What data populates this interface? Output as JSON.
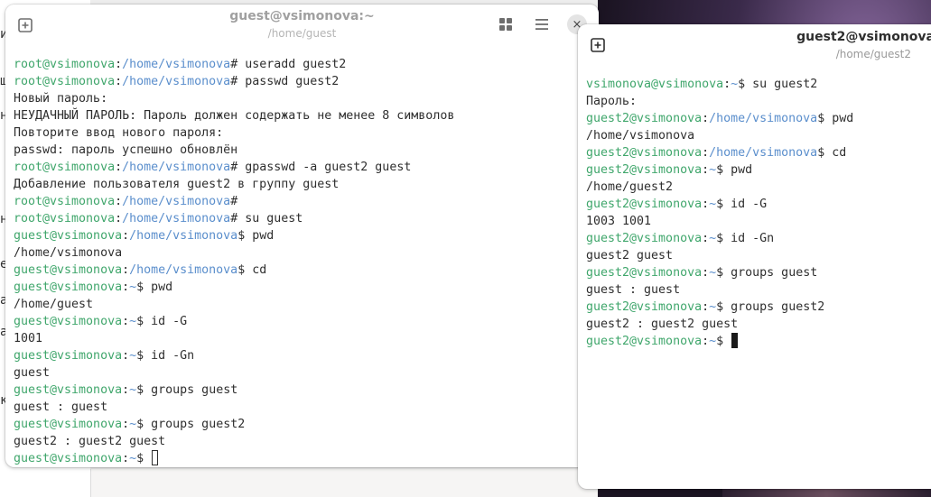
{
  "window1": {
    "title": "guest@vsimonova:~",
    "subtitle": "/home/guest",
    "lines": [
      {
        "user": "root@vsimonova",
        "path": "/home/vsimonova",
        "sym": "#",
        "cmd": " useradd guest2"
      },
      {
        "user": "root@vsimonova",
        "path": "/home/vsimonova",
        "sym": "#",
        "cmd": " passwd guest2"
      },
      {
        "text": "Новый пароль:"
      },
      {
        "text": "НЕУДАЧНЫЙ ПАРОЛЬ: Пароль должен содержать не менее 8 символов"
      },
      {
        "text": "Повторите ввод нового пароля:"
      },
      {
        "text": "passwd: пароль успешно обновлён"
      },
      {
        "user": "root@vsimonova",
        "path": "/home/vsimonova",
        "sym": "#",
        "cmd": " gpasswd -a guest2 guest"
      },
      {
        "text": "Добавление пользователя guest2 в группу guest"
      },
      {
        "user": "root@vsimonova",
        "path": "/home/vsimonova",
        "sym": "#",
        "cmd": ""
      },
      {
        "user": "root@vsimonova",
        "path": "/home/vsimonova",
        "sym": "#",
        "cmd": " su guest"
      },
      {
        "user": "guest@vsimonova",
        "path": "/home/vsimonova",
        "sym": "$",
        "cmd": " pwd"
      },
      {
        "text": "/home/vsimonova"
      },
      {
        "user": "guest@vsimonova",
        "path": "/home/vsimonova",
        "sym": "$",
        "cmd": " cd"
      },
      {
        "user": "guest@vsimonova",
        "path": "~",
        "sym": "$",
        "cmd": " pwd"
      },
      {
        "text": "/home/guest"
      },
      {
        "user": "guest@vsimonova",
        "path": "~",
        "sym": "$",
        "cmd": " id -G"
      },
      {
        "text": "1001"
      },
      {
        "user": "guest@vsimonova",
        "path": "~",
        "sym": "$",
        "cmd": " id -Gn"
      },
      {
        "text": "guest"
      },
      {
        "user": "guest@vsimonova",
        "path": "~",
        "sym": "$",
        "cmd": " groups guest"
      },
      {
        "text": "guest : guest"
      },
      {
        "user": "guest@vsimonova",
        "path": "~",
        "sym": "$",
        "cmd": " groups guest2"
      },
      {
        "text": "guest2 : guest2 guest"
      },
      {
        "user": "guest@vsimonova",
        "path": "~",
        "sym": "$",
        "cmd": " ",
        "cursor": "hollow"
      }
    ]
  },
  "window2": {
    "title": "guest2@vsimonova",
    "subtitle": "/home/guest2",
    "lines": [
      {
        "user": "vsimonova@vsimonova",
        "path": "~",
        "sym": "$",
        "cmd": " su guest2"
      },
      {
        "text": "Пароль:"
      },
      {
        "user": "guest2@vsimonova",
        "path": "/home/vsimonova",
        "sym": "$",
        "cmd": " pwd"
      },
      {
        "text": "/home/vsimonova"
      },
      {
        "user": "guest2@vsimonova",
        "path": "/home/vsimonova",
        "sym": "$",
        "cmd": " cd"
      },
      {
        "user": "guest2@vsimonova",
        "path": "~",
        "sym": "$",
        "cmd": " pwd"
      },
      {
        "text": "/home/guest2"
      },
      {
        "user": "guest2@vsimonova",
        "path": "~",
        "sym": "$",
        "cmd": " id -G"
      },
      {
        "text": "1003 1001"
      },
      {
        "user": "guest2@vsimonova",
        "path": "~",
        "sym": "$",
        "cmd": " id -Gn"
      },
      {
        "text": "guest2 guest"
      },
      {
        "user": "guest2@vsimonova",
        "path": "~",
        "sym": "$",
        "cmd": " groups guest"
      },
      {
        "text": "guest : guest"
      },
      {
        "user": "guest2@vsimonova",
        "path": "~",
        "sym": "$",
        "cmd": " groups guest2"
      },
      {
        "text": "guest2 : guest2 guest"
      },
      {
        "user": "guest2@vsimonova",
        "path": "~",
        "sym": "$",
        "cmd": " ",
        "cursor": "solid"
      }
    ]
  },
  "side_chars": [
    "и",
    "ш",
    "н",
    "н",
    "е",
    "а",
    "а",
    "к"
  ],
  "icons": {
    "new_tab": "new-tab-icon",
    "grid": "grid-icon",
    "menu": "hamburger-menu-icon",
    "close": "close-icon",
    "close_glyph": "×"
  },
  "colors": {
    "user_host": "#3fa66b",
    "path": "#5a8ecc",
    "text": "#2e2e2e"
  }
}
